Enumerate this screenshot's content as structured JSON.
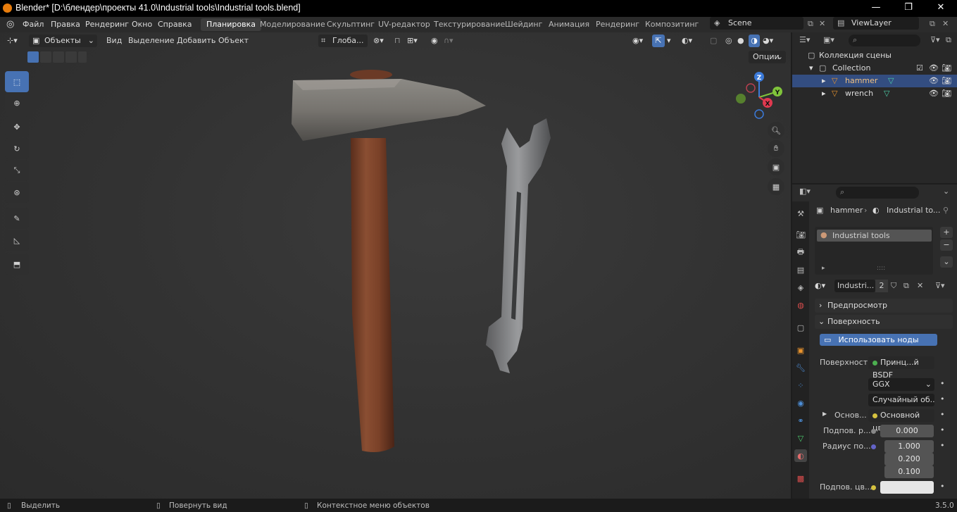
{
  "window": {
    "title": "Blender* [D:\\блендер\\проекты 41.0\\Industrial tools\\Industrial tools.blend]",
    "minimize": "—",
    "maximize": "❐",
    "close": "✕"
  },
  "menubar": {
    "menus": [
      "Файл",
      "Правка",
      "Рендеринг",
      "Окно",
      "Справка"
    ],
    "workspaces": [
      "Планировка",
      "Моделирование",
      "Скульптинг",
      "UV-редактор",
      "Текстурирование",
      "Шейдинг",
      "Анимация",
      "Рендеринг",
      "Композитинг"
    ],
    "active_workspace": "Планировка",
    "scene": "Scene",
    "view_layer": "ViewLayer"
  },
  "viewport_header": {
    "mode": "Объекты",
    "menus": [
      "Вид",
      "Выделение",
      "Добавить",
      "Объект"
    ],
    "orientation": "Глоба...",
    "options": "Опции"
  },
  "gizmo": {
    "z": "Z",
    "y": "Y",
    "x": "X"
  },
  "outliner": {
    "scene_collection": "Коллекция сцены",
    "collection": "Collection",
    "objects": [
      "hammer",
      "wrench"
    ],
    "selected": "hammer"
  },
  "properties": {
    "breadcrumb_object": "hammer",
    "breadcrumb_material": "Industrial to...",
    "slot_material": "Industrial tools",
    "material_name": "Industri...",
    "users": "2",
    "panels": {
      "preview": "Предпросмотр",
      "surface": "Поверхность"
    },
    "use_nodes": "Использовать ноды",
    "surface_label": "Поверхность",
    "surface_value": "Принц...й BSDF",
    "distribution": "GGX",
    "subsurface_method": "Случайный об...",
    "base_color_label": "Основ...",
    "base_color_value": "Основной цвет",
    "subsurface_label": "Подпов. р...",
    "subsurface_value": "0.000",
    "radius_label": "Радиус по...",
    "radius_values": [
      "1.000",
      "0.200",
      "0.100"
    ],
    "subsurface_color_label": "Подпов. цв..."
  },
  "statusbar": {
    "select": "Выделить",
    "rotate": "Повернуть вид",
    "context": "Контекстное меню объектов",
    "version": "3.5.0"
  },
  "colors": {
    "accent_blue": "#4772b3",
    "selected_row": "#334d80",
    "axis_x": "#e0394f",
    "axis_y": "#80c43b",
    "axis_z": "#3b7ad9"
  }
}
